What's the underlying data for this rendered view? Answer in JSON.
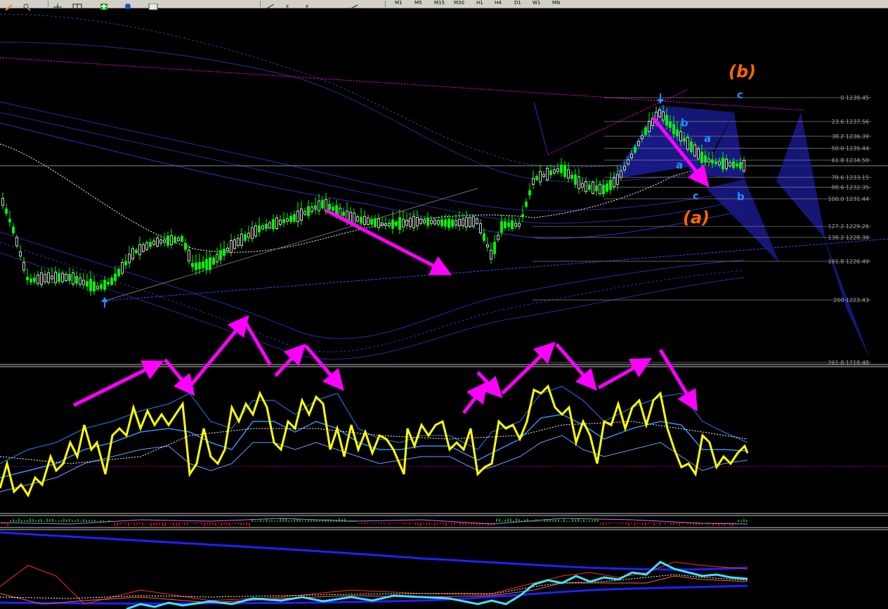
{
  "toolbar": {
    "buttons": [
      "pencil-icon",
      "zoom-icon",
      "crosshair-icon",
      "grid-icon",
      "add-icon",
      "refresh-icon",
      "calendar-icon",
      "line-icon",
      "fib-icon",
      "text-icon",
      "arrow-icon"
    ],
    "timeframes": [
      "M1",
      "M5",
      "M15",
      "M30",
      "H1",
      "H4",
      "D1",
      "W1",
      "MN"
    ]
  },
  "colors": {
    "bull": "#00ff00",
    "bear": "#ffffff",
    "fibo": "#808080",
    "pattern_fill": "#1a1a8c",
    "arrow": "#ff00ff",
    "oscillator": "#ffff00",
    "wave_major": "#ff6600",
    "wave_minor": "#1e90ff"
  },
  "fibonacci_levels": [
    {
      "label": "0 1239.45"
    },
    {
      "label": "23.6 1237.56"
    },
    {
      "label": "38.2 1236.39"
    },
    {
      "label": "50.0 1235.44"
    },
    {
      "label": "61.8 1234.50"
    },
    {
      "label": "78.6 1233.15"
    },
    {
      "label": "88.6 1232.35"
    },
    {
      "label": "100.0 1231.44"
    },
    {
      "label": "127.2 1229.26"
    },
    {
      "label": "138.2 1228.38"
    },
    {
      "label": "161.8 1226.49"
    },
    {
      "label": "200 1223.43"
    },
    {
      "label": "261.8 1218.48"
    }
  ],
  "wave_labels": {
    "major_b": "(b)",
    "major_a": "(a)",
    "minor_c_top": "c",
    "minor_b_top": "b",
    "minor_a_top": "a",
    "minor_a_mid": "a",
    "minor_c_low": "c",
    "minor_b_low": "b"
  }
}
